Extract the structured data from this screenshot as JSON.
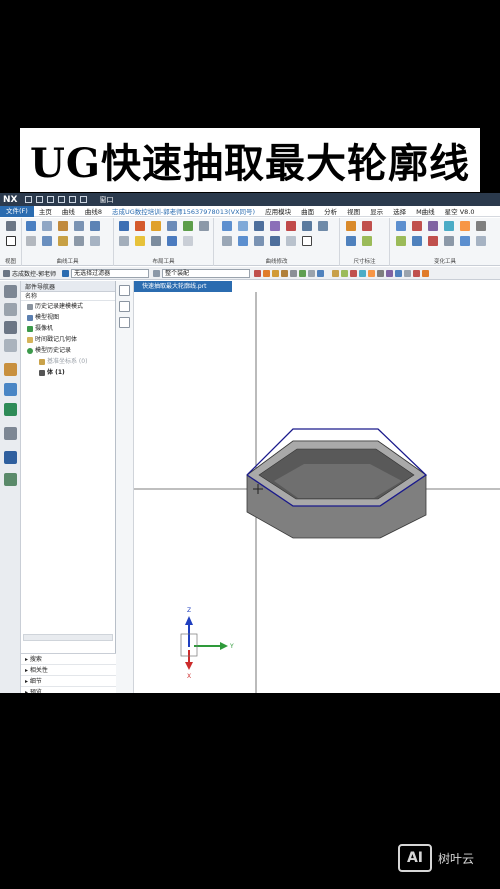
{
  "video_title": "UG快速抽取最大轮廓线",
  "app": {
    "logo": "NX",
    "window_menu": "窗口",
    "menu": [
      "文件(F)",
      "主页",
      "曲线",
      "曲线8",
      "志成UG数控培训-郭老师15637978013(VX同号)",
      "应用模块",
      "曲面",
      "分析",
      "视图",
      "显示",
      "选择",
      "M曲线",
      "星空 V8.0"
    ],
    "ribbon_groups": [
      "视图",
      "曲线工具",
      "布局工具",
      "曲线修改",
      "尺寸标注",
      "变化工具"
    ],
    "selection_bar": {
      "author": "志成数控-郭老师",
      "filter": "无选择过滤器",
      "scope": "整个装配"
    },
    "navigator": {
      "title": "部件导航器",
      "column": "名称",
      "items": [
        {
          "label": "历史记录建模模式"
        },
        {
          "label": "模型视图"
        },
        {
          "label": "摄像机"
        },
        {
          "label": "时间戳记几何体"
        },
        {
          "label": "模型历史记录"
        },
        {
          "label": "基准坐标系 (0)"
        },
        {
          "label": "体 (1)"
        }
      ],
      "panels": [
        "搜索",
        "相关性",
        "细节",
        "预览"
      ]
    },
    "doc_tab": "快速抽取最大轮廓线.prt",
    "axis_labels": {
      "z": "Z",
      "y": "Y",
      "x": "X"
    }
  },
  "watermark": {
    "badge": "AI",
    "text": "树叶云"
  },
  "colors": {
    "titlebar": "#2b3a4d",
    "accent": "#2b6cb0",
    "model_gray": "#7f7f7f",
    "outline": "#1a1a8c"
  }
}
